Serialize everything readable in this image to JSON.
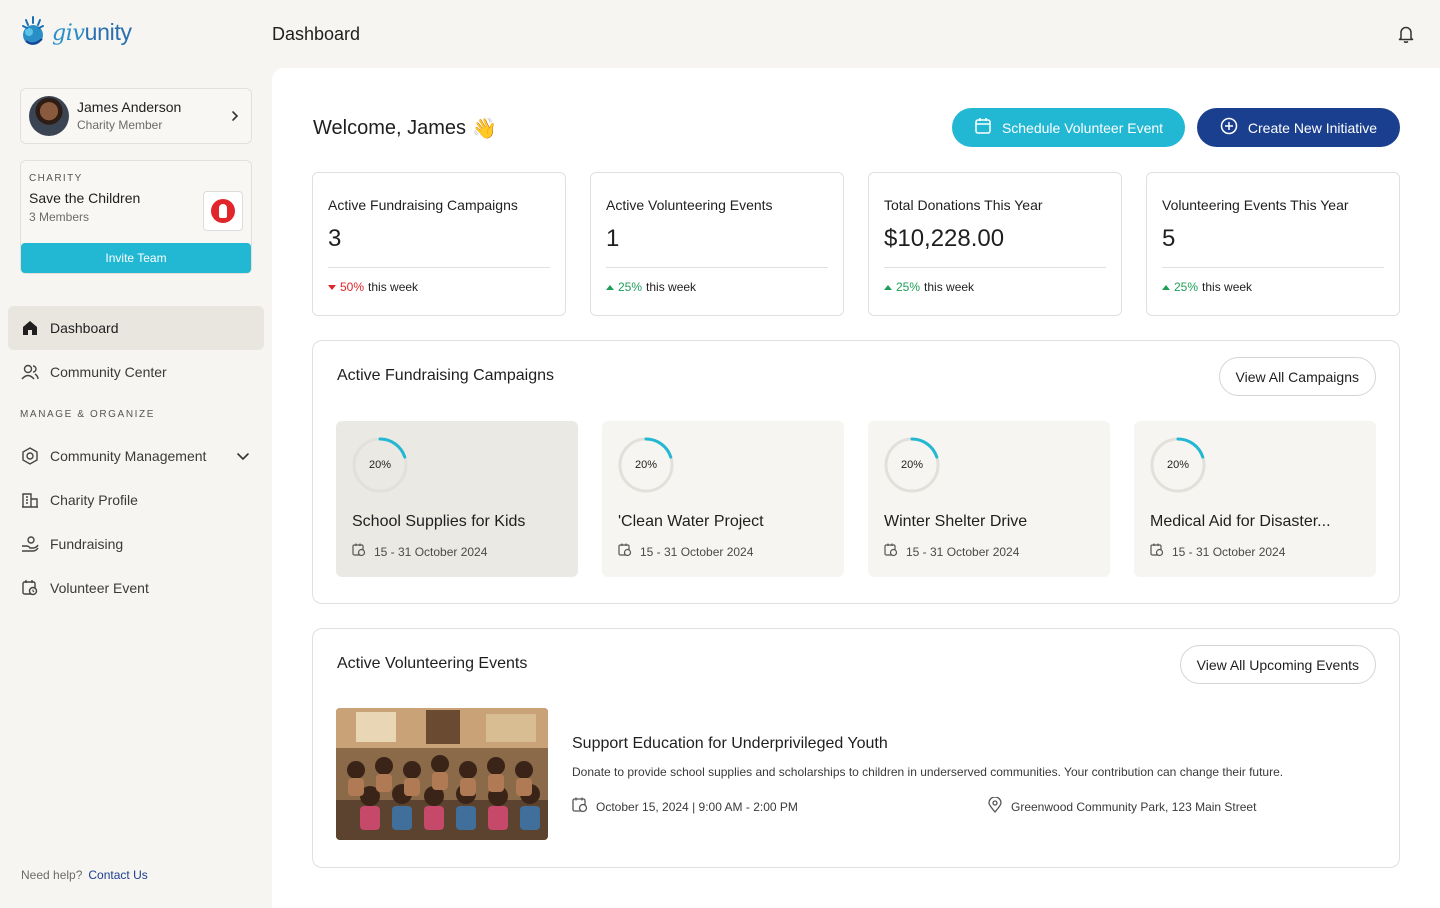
{
  "app": {
    "logo_prefix": "giv",
    "logo_suffix": "unity"
  },
  "header": {
    "title": "Dashboard"
  },
  "user": {
    "name": "James Anderson",
    "role": "Charity Member"
  },
  "charity": {
    "label": "CHARITY",
    "name": "Save the Children",
    "members": "3 Members",
    "invite_label": "Invite Team"
  },
  "nav": {
    "dashboard": "Dashboard",
    "community_center": "Community Center",
    "section_label": "MANAGE & ORGANIZE",
    "community_management": "Community Management",
    "charity_profile": "Charity Profile",
    "fundraising": "Fundraising",
    "volunteer_event": "Volunteer Event"
  },
  "help": {
    "text": "Need help?",
    "link": "Contact Us"
  },
  "welcome": {
    "text": "Welcome, James",
    "emoji": "👋"
  },
  "actions": {
    "schedule": "Schedule Volunteer Event",
    "create": "Create New Initiative"
  },
  "stats": [
    {
      "title": "Active Fundraising Campaigns",
      "value": "3",
      "change": "50%",
      "direction": "down",
      "suffix": "this week"
    },
    {
      "title": "Active Volunteering Events",
      "value": "1",
      "change": "25%",
      "direction": "up",
      "suffix": "this week"
    },
    {
      "title": "Total Donations This Year",
      "value": "$10,228.00",
      "change": "25%",
      "direction": "up",
      "suffix": "this week"
    },
    {
      "title": "Volunteering Events This Year",
      "value": "5",
      "change": "25%",
      "direction": "up",
      "suffix": "this week"
    }
  ],
  "campaigns_section": {
    "title": "Active Fundraising Campaigns",
    "view_all": "View All Campaigns",
    "items": [
      {
        "progress_label": "20%",
        "progress": 0.2,
        "name": "School Supplies for Kids",
        "date": "15 - 31 October 2024"
      },
      {
        "progress_label": "20%",
        "progress": 0.2,
        "name": "'Clean Water Project",
        "date": "15 - 31 October 2024"
      },
      {
        "progress_label": "20%",
        "progress": 0.2,
        "name": "Winter Shelter Drive",
        "date": "15 - 31 October 2024"
      },
      {
        "progress_label": "20%",
        "progress": 0.2,
        "name": "Medical Aid for Disaster...",
        "date": "15 - 31 October 2024"
      }
    ]
  },
  "events_section": {
    "title": "Active Volunteering Events",
    "view_all": "View All Upcoming Events",
    "event": {
      "title": "Support Education for Underprivileged Youth",
      "description": "Donate to provide school supplies and scholarships to children in underserved communities. Your contribution can change their future.",
      "datetime": "October 15, 2024 | 9:00 AM - 2:00 PM",
      "location": "Greenwood Community Park, 123 Main Street"
    }
  },
  "colors": {
    "accent": "#22b8d4",
    "primary": "#1b3f8f",
    "positive": "#1f9e5a",
    "negative": "#e0262b",
    "background": "#f6f5f1"
  }
}
